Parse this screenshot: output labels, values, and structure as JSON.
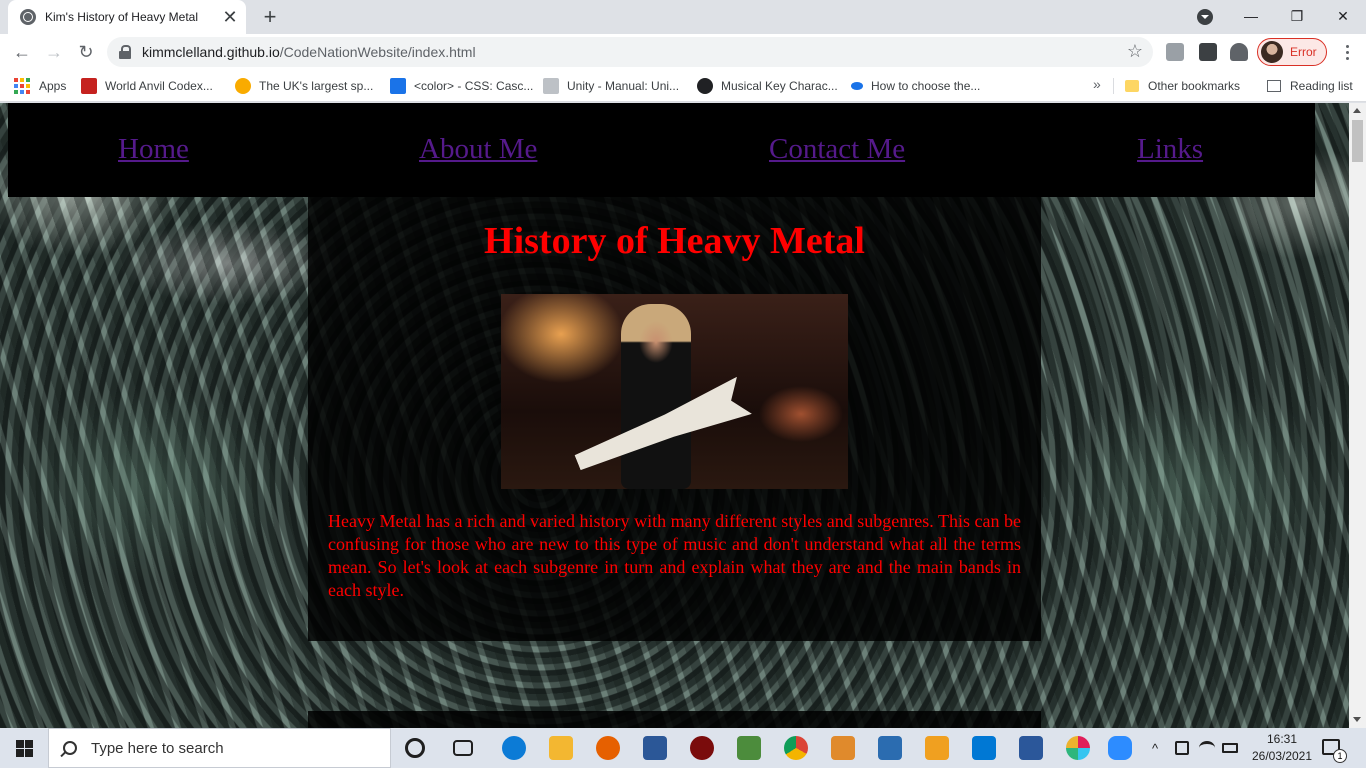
{
  "browser": {
    "tab": {
      "title": "Kim's History of Heavy Metal",
      "close_glyph": "✕"
    },
    "new_tab_glyph": "+",
    "window_controls": {
      "minimize": "—",
      "restore": "❐",
      "close": "✕"
    },
    "toolbar": {
      "back": "←",
      "forward": "→",
      "reload": "↻",
      "star": "☆"
    },
    "address": {
      "host": "kimmclelland.github.io",
      "path": "/CodeNationWebsite/index.html"
    },
    "profile": {
      "label": "Error",
      "status_color": "#d93025"
    },
    "bookmarks": [
      {
        "label": "Apps",
        "icon": "apps-grid-icon"
      },
      {
        "label": "World Anvil Codex...",
        "icon": "world-anvil-icon",
        "color": "#c5221f"
      },
      {
        "label": "The UK's largest sp...",
        "icon": "uk-search-icon",
        "color": "#f9ab00"
      },
      {
        "label": "<color> - CSS: Casc...",
        "icon": "mdn-icon",
        "color": "#1a73e8"
      },
      {
        "label": "Unity - Manual: Uni...",
        "icon": "unity-icon",
        "color": "#5f6368"
      },
      {
        "label": "Musical Key Charac...",
        "icon": "ln-icon",
        "color": "#202124"
      },
      {
        "label": "How to choose the...",
        "icon": "eye-icon",
        "color": "#1a73e8"
      }
    ],
    "bookmarks_more": "»",
    "other_bookmarks": "Other bookmarks",
    "reading_list": "Reading list"
  },
  "page": {
    "nav": [
      {
        "label": "Home"
      },
      {
        "label": "About Me"
      },
      {
        "label": "Contact Me"
      },
      {
        "label": "Links"
      }
    ],
    "title": "History of Heavy Metal",
    "hero_image": "guitarist-on-stage-image",
    "description": "Heavy Metal has a rich and varied history with many different styles and subgenres. This can be confusing for those who are new to this type of music and don't understand what all the terms mean. So let's look at each subgenre in turn and explain what they are and the main bands in each style.",
    "text_color": "#ff0000",
    "link_color": "#551a8b"
  },
  "taskbar": {
    "search_placeholder": "Type here to search",
    "apps": [
      {
        "name": "cortana-icon",
        "color": "#1f1f1f"
      },
      {
        "name": "task-view-icon",
        "color": "#1f1f1f"
      },
      {
        "name": "edge-icon",
        "color": "#0c7bd6"
      },
      {
        "name": "file-explorer-icon",
        "color": "#f3b731"
      },
      {
        "name": "firefox-icon",
        "color": "#e66000"
      },
      {
        "name": "remote-desktop-icon",
        "color": "#2b5797"
      },
      {
        "name": "app-red-icon",
        "color": "#7a0c0c"
      },
      {
        "name": "app-green-icon",
        "color": "#4c8c3c"
      },
      {
        "name": "chrome-icon",
        "color": "#db4437"
      },
      {
        "name": "installer-icon",
        "color": "#e08a2c"
      },
      {
        "name": "chat-icon",
        "color": "#2b6cb0"
      },
      {
        "name": "media-player-icon",
        "color": "#f0a020"
      },
      {
        "name": "mail-icon",
        "color": "#0078d4"
      },
      {
        "name": "word-icon",
        "color": "#2b579a"
      },
      {
        "name": "slack-icon",
        "color": "#611f69"
      },
      {
        "name": "zoom-icon",
        "color": "#2d8cff"
      }
    ],
    "tray_chevron": "^",
    "time": "16:31",
    "date": "26/03/2021",
    "notifications": "1"
  }
}
